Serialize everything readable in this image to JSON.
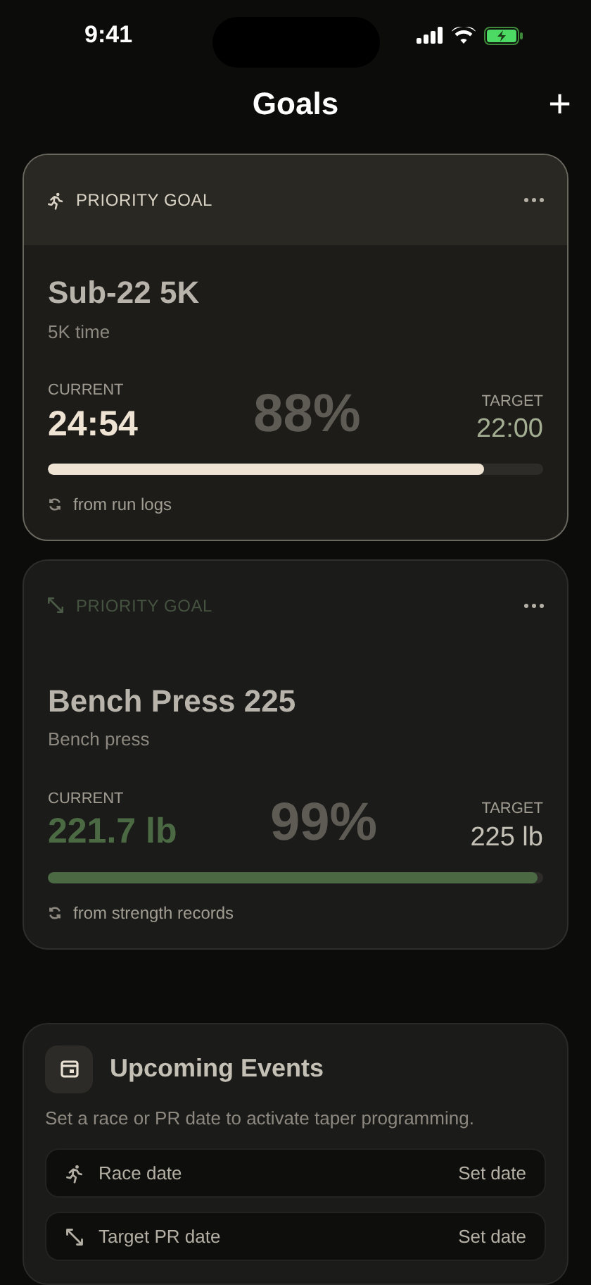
{
  "status_bar": {
    "time": "9:41"
  },
  "header": {
    "title": "Goals",
    "add": "+"
  },
  "goals": [
    {
      "kind": "run",
      "highlighted": true,
      "badge": "PRIORITY GOAL",
      "title": "Sub-22 5K",
      "subtitle": "5K time",
      "current_label": "CURRENT",
      "current": "24:54",
      "percent": "88%",
      "target_label": "TARGET",
      "target": "22:00",
      "level": 0.88,
      "color": "#efe3d4",
      "source": "from run logs"
    },
    {
      "kind": "strength",
      "highlighted": false,
      "badge": "PRIORITY GOAL",
      "title": "Bench Press 225",
      "subtitle": "Bench press",
      "current_label": "CURRENT",
      "current": "221.7 lb",
      "percent": "99%",
      "target_label": "TARGET",
      "target": "225 lb",
      "level": 0.99,
      "color": "#4b6a44",
      "source": "from strength records"
    }
  ],
  "events": {
    "title": "Upcoming Events",
    "description": "Set a race or PR date to activate taper programming.",
    "rows": [
      {
        "kind": "run",
        "label": "Race date",
        "action": "Set date"
      },
      {
        "kind": "strength",
        "label": "Target PR date",
        "action": "Set date"
      }
    ]
  }
}
